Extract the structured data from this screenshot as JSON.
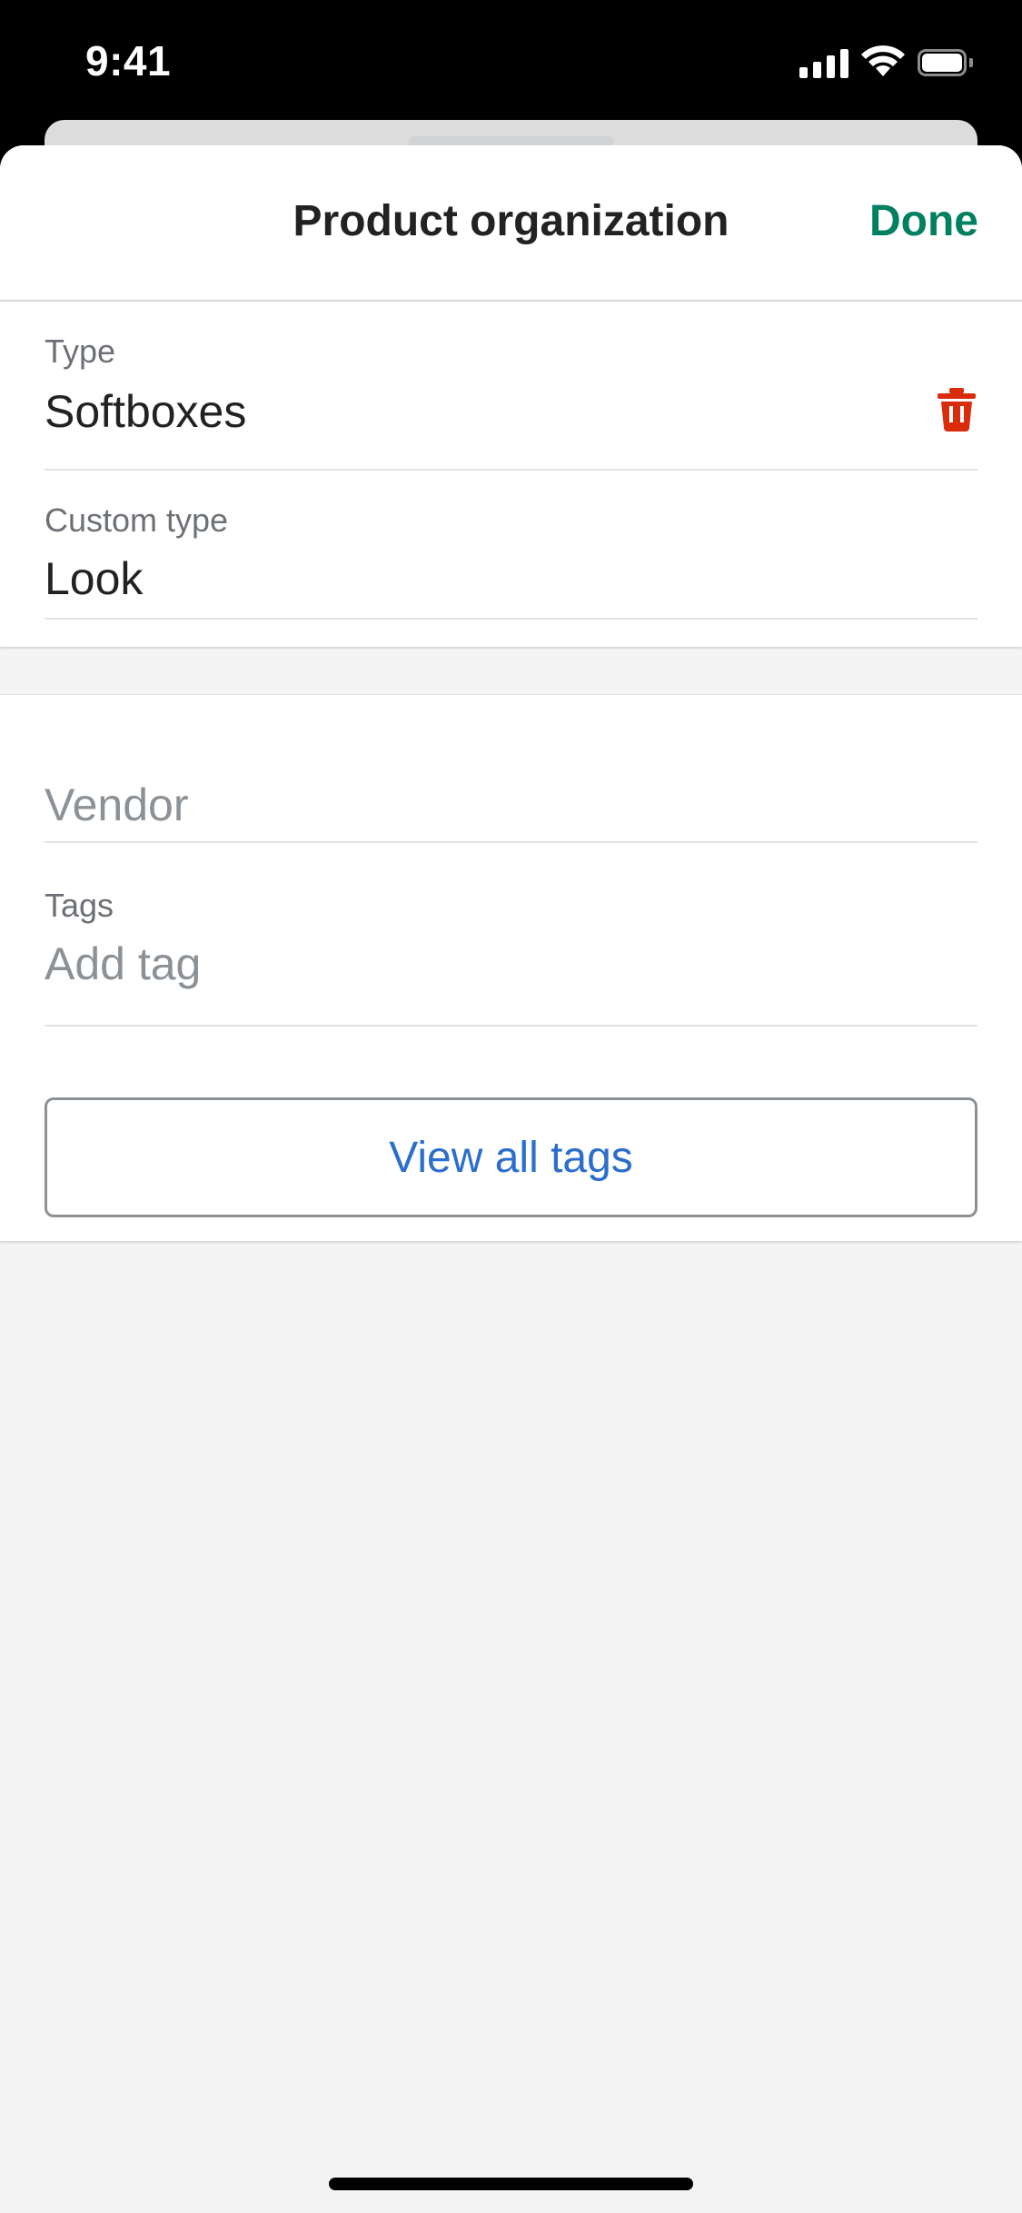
{
  "status_bar": {
    "time": "9:41"
  },
  "header": {
    "title": "Product organization",
    "done_label": "Done"
  },
  "type_field": {
    "label": "Type",
    "value": "Softboxes"
  },
  "custom_type_field": {
    "label": "Custom type",
    "value": "Look"
  },
  "vendor_field": {
    "placeholder": "Vendor"
  },
  "tags_field": {
    "label": "Tags",
    "placeholder": "Add tag"
  },
  "view_tags_button": {
    "label": "View all tags"
  },
  "icons": {
    "delete": "trash-icon"
  },
  "colors": {
    "done": "#008060",
    "delete": "#d82c0d",
    "link": "#2c6ecb"
  }
}
